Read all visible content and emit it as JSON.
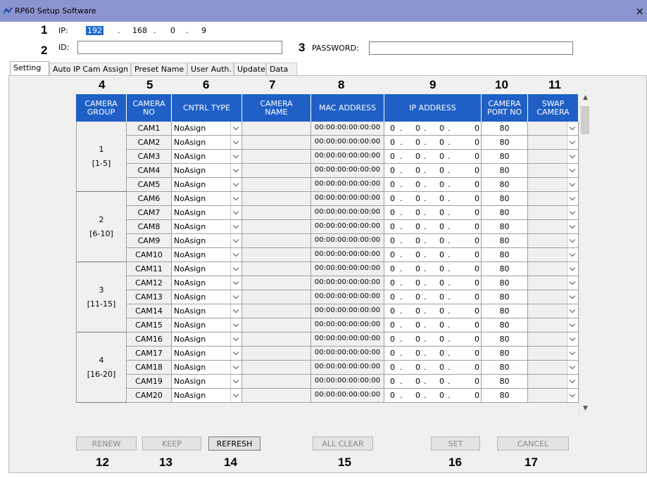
{
  "window": {
    "title": "RP60 Setup Software",
    "close": "×"
  },
  "connection": {
    "ip_label": "IP:",
    "ip": [
      "192",
      "168",
      "0",
      "9"
    ],
    "id_label": "ID:",
    "id_value": "",
    "password_label": "PASSWORD:",
    "password_value": ""
  },
  "tabs": [
    "Setting",
    "Auto IP Cam Assign",
    "Preset Name",
    "User Auth.",
    "Update",
    "Data"
  ],
  "active_tab": "Setting",
  "callouts": {
    "ip": "1",
    "id": "2",
    "password": "3",
    "camera_group": "4",
    "camera_no": "5",
    "cntrl_type": "6",
    "camera_name": "7",
    "mac_address": "8",
    "ip_address": "9",
    "camera_port_no": "10",
    "swap_camera": "11",
    "renew": "12",
    "keep": "13",
    "refresh": "14",
    "all_clear": "15",
    "set": "16",
    "cancel": "17"
  },
  "table": {
    "headers": [
      "CAMERA\nGROUP",
      "CAMERA\nNO",
      "CNTRL TYPE",
      "CAMERA\nNAME",
      "MAC ADDRESS",
      "IP ADDRESS",
      "CAMERA\nPORT NO",
      "SWAP\nCAMERA"
    ],
    "groups": [
      {
        "num": "1",
        "range": "[1-5]"
      },
      {
        "num": "2",
        "range": "[6-10]"
      },
      {
        "num": "3",
        "range": "[11-15]"
      },
      {
        "num": "4",
        "range": "[16-20]"
      }
    ],
    "rows": [
      {
        "cam": "CAM1",
        "ctrl": "NoAsign",
        "name": "",
        "mac": "00:00:00:00:00:00",
        "ip": [
          "0",
          "0",
          "0",
          "0"
        ],
        "port": "80",
        "swap": ""
      },
      {
        "cam": "CAM2",
        "ctrl": "NoAsign",
        "name": "",
        "mac": "00:00:00:00:00:00",
        "ip": [
          "0",
          "0",
          "0",
          "0"
        ],
        "port": "80",
        "swap": ""
      },
      {
        "cam": "CAM3",
        "ctrl": "NoAsign",
        "name": "",
        "mac": "00:00:00:00:00:00",
        "ip": [
          "0",
          "0",
          "0",
          "0"
        ],
        "port": "80",
        "swap": ""
      },
      {
        "cam": "CAM4",
        "ctrl": "NoAsign",
        "name": "",
        "mac": "00:00:00:00:00:00",
        "ip": [
          "0",
          "0",
          "0",
          "0"
        ],
        "port": "80",
        "swap": ""
      },
      {
        "cam": "CAM5",
        "ctrl": "NoAsign",
        "name": "",
        "mac": "00:00:00:00:00:00",
        "ip": [
          "0",
          "0",
          "0",
          "0"
        ],
        "port": "80",
        "swap": ""
      },
      {
        "cam": "CAM6",
        "ctrl": "NoAsign",
        "name": "",
        "mac": "00:00:00:00:00:00",
        "ip": [
          "0",
          "0",
          "0",
          "0"
        ],
        "port": "80",
        "swap": ""
      },
      {
        "cam": "CAM7",
        "ctrl": "NoAsign",
        "name": "",
        "mac": "00:00:00:00:00:00",
        "ip": [
          "0",
          "0",
          "0",
          "0"
        ],
        "port": "80",
        "swap": ""
      },
      {
        "cam": "CAM8",
        "ctrl": "NoAsign",
        "name": "",
        "mac": "00:00:00:00:00:00",
        "ip": [
          "0",
          "0",
          "0",
          "0"
        ],
        "port": "80",
        "swap": ""
      },
      {
        "cam": "CAM9",
        "ctrl": "NoAsign",
        "name": "",
        "mac": "00:00:00:00:00:00",
        "ip": [
          "0",
          "0",
          "0",
          "0"
        ],
        "port": "80",
        "swap": ""
      },
      {
        "cam": "CAM10",
        "ctrl": "NoAsign",
        "name": "",
        "mac": "00:00:00:00:00:00",
        "ip": [
          "0",
          "0",
          "0",
          "0"
        ],
        "port": "80",
        "swap": ""
      },
      {
        "cam": "CAM11",
        "ctrl": "NoAsign",
        "name": "",
        "mac": "00:00:00:00:00:00",
        "ip": [
          "0",
          "0",
          "0",
          "0"
        ],
        "port": "80",
        "swap": ""
      },
      {
        "cam": "CAM12",
        "ctrl": "NoAsign",
        "name": "",
        "mac": "00:00:00:00:00:00",
        "ip": [
          "0",
          "0",
          "0",
          "0"
        ],
        "port": "80",
        "swap": ""
      },
      {
        "cam": "CAM13",
        "ctrl": "NoAsign",
        "name": "",
        "mac": "00:00:00:00:00:00",
        "ip": [
          "0",
          "0",
          "0",
          "0"
        ],
        "port": "80",
        "swap": ""
      },
      {
        "cam": "CAM14",
        "ctrl": "NoAsign",
        "name": "",
        "mac": "00:00:00:00:00:00",
        "ip": [
          "0",
          "0",
          "0",
          "0"
        ],
        "port": "80",
        "swap": ""
      },
      {
        "cam": "CAM15",
        "ctrl": "NoAsign",
        "name": "",
        "mac": "00:00:00:00:00:00",
        "ip": [
          "0",
          "0",
          "0",
          "0"
        ],
        "port": "80",
        "swap": ""
      },
      {
        "cam": "CAM16",
        "ctrl": "NoAsign",
        "name": "",
        "mac": "00:00:00:00:00:00",
        "ip": [
          "0",
          "0",
          "0",
          "0"
        ],
        "port": "80",
        "swap": ""
      },
      {
        "cam": "CAM17",
        "ctrl": "NoAsign",
        "name": "",
        "mac": "00:00:00:00:00:00",
        "ip": [
          "0",
          "0",
          "0",
          "0"
        ],
        "port": "80",
        "swap": ""
      },
      {
        "cam": "CAM18",
        "ctrl": "NoAsign",
        "name": "",
        "mac": "00:00:00:00:00:00",
        "ip": [
          "0",
          "0",
          "0",
          "0"
        ],
        "port": "80",
        "swap": ""
      },
      {
        "cam": "CAM19",
        "ctrl": "NoAsign",
        "name": "",
        "mac": "00:00:00:00:00:00",
        "ip": [
          "0",
          "0",
          "0",
          "0"
        ],
        "port": "80",
        "swap": ""
      },
      {
        "cam": "CAM20",
        "ctrl": "NoAsign",
        "name": "",
        "mac": "00:00:00:00:00:00",
        "ip": [
          "0",
          "0",
          "0",
          "0"
        ],
        "port": "80",
        "swap": ""
      }
    ]
  },
  "buttons": [
    {
      "label": "RENEW",
      "enabled": false
    },
    {
      "label": "KEEP",
      "enabled": false
    },
    {
      "label": "REFRESH",
      "enabled": true
    },
    {
      "label": "ALL CLEAR",
      "enabled": false
    },
    {
      "label": "SET",
      "enabled": false
    },
    {
      "label": "CANCEL",
      "enabled": false
    }
  ],
  "colors": {
    "title_bar": "#8c94cf",
    "header_blue": "#1f5fc6",
    "ip_selection": "#1c6bd3",
    "panel_bg": "#f0f0f0"
  }
}
